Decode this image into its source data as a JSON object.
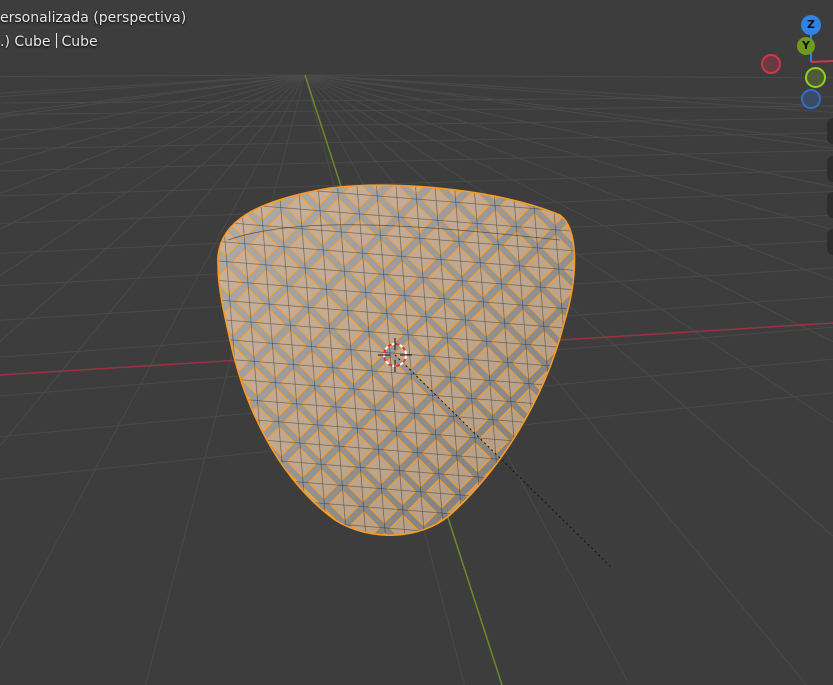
{
  "viewport": {
    "view_label": "ersonalizada (perspectiva)",
    "collection_prefix": ".) Cube",
    "object_name": "Cube"
  },
  "gizmo": {
    "z_label": "Z",
    "y_label": "Y"
  },
  "colors": {
    "background": "#3d3d3d",
    "x_axis": "#9a3340",
    "y_axis": "#6a8a2a",
    "select": "#ff9a1f",
    "z_gizmo": "#2f83e4",
    "y_gizmo": "#6f9a20",
    "x_gizmo": "#d0364c"
  }
}
